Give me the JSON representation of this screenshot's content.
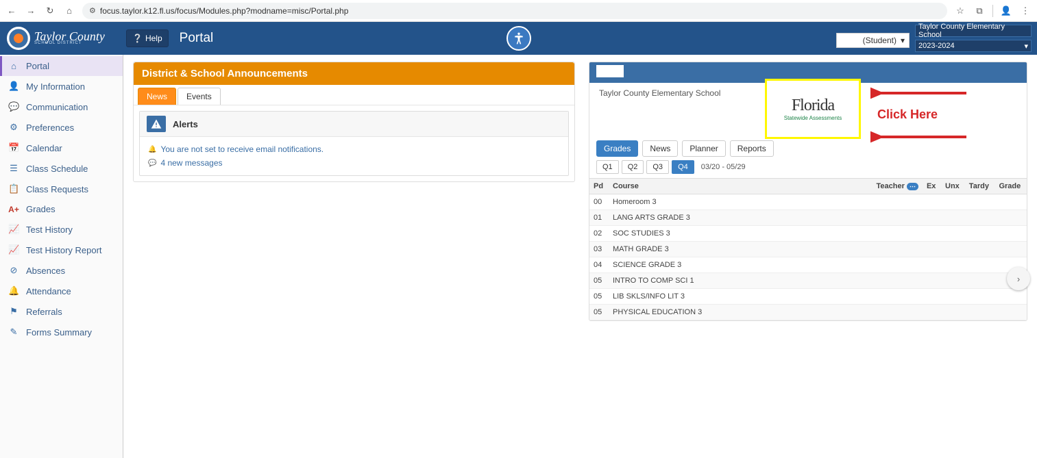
{
  "browser": {
    "url": "focus.taylor.k12.fl.us/focus/Modules.php?modname=misc/Portal.php"
  },
  "header": {
    "district": "Taylor County",
    "district_sub": "SCHOOL DISTRICT",
    "help": "Help",
    "title": "Portal",
    "user_select": "(Student)",
    "school_select": "Taylor County Elementary School",
    "year_select": "2023-2024"
  },
  "sidebar": {
    "items": [
      {
        "label": "Portal",
        "icon": "home",
        "active": true
      },
      {
        "label": "My Information",
        "icon": "user"
      },
      {
        "label": "Communication",
        "icon": "comment"
      },
      {
        "label": "Preferences",
        "icon": "gear"
      },
      {
        "label": "Calendar",
        "icon": "calendar"
      },
      {
        "label": "Class Schedule",
        "icon": "list"
      },
      {
        "label": "Class Requests",
        "icon": "clipboard"
      },
      {
        "label": "Grades",
        "icon": "aplus"
      },
      {
        "label": "Test History",
        "icon": "chart"
      },
      {
        "label": "Test History Report",
        "icon": "chart"
      },
      {
        "label": "Absences",
        "icon": "ban"
      },
      {
        "label": "Attendance",
        "icon": "bell"
      },
      {
        "label": "Referrals",
        "icon": "flag"
      },
      {
        "label": "Forms Summary",
        "icon": "edit"
      }
    ]
  },
  "announcements": {
    "title": "District & School Announcements",
    "tabs": [
      {
        "label": "News",
        "active": true
      },
      {
        "label": "Events"
      }
    ],
    "alerts_title": "Alerts",
    "alerts": [
      "You are not set to receive email notifications.",
      "4 new messages"
    ]
  },
  "right_panel": {
    "school_name": "Taylor County Elementary School",
    "florida_title": "Florida",
    "florida_sub": "Statewide Assessments",
    "click_here": "Click Here",
    "grade_tabs": [
      {
        "label": "Grades",
        "active": true
      },
      {
        "label": "News"
      },
      {
        "label": "Planner"
      },
      {
        "label": "Reports"
      }
    ],
    "quarters": [
      {
        "label": "Q1"
      },
      {
        "label": "Q2"
      },
      {
        "label": "Q3"
      },
      {
        "label": "Q4",
        "active": true
      }
    ],
    "quarter_range": "03/20 - 05/29",
    "table": {
      "headers": [
        "Pd",
        "Course",
        "Teacher",
        "Ex",
        "Unx",
        "Tardy",
        "Grade"
      ],
      "rows": [
        {
          "pd": "00",
          "course": "Homeroom 3"
        },
        {
          "pd": "01",
          "course": "LANG ARTS GRADE 3"
        },
        {
          "pd": "02",
          "course": "SOC STUDIES 3"
        },
        {
          "pd": "03",
          "course": "MATH GRADE 3"
        },
        {
          "pd": "04",
          "course": "SCIENCE GRADE 3"
        },
        {
          "pd": "05",
          "course": "INTRO TO COMP SCI 1"
        },
        {
          "pd": "05",
          "course": "LIB SKLS/INFO LIT 3"
        },
        {
          "pd": "05",
          "course": "PHYSICAL EDUCATION 3"
        }
      ]
    }
  }
}
